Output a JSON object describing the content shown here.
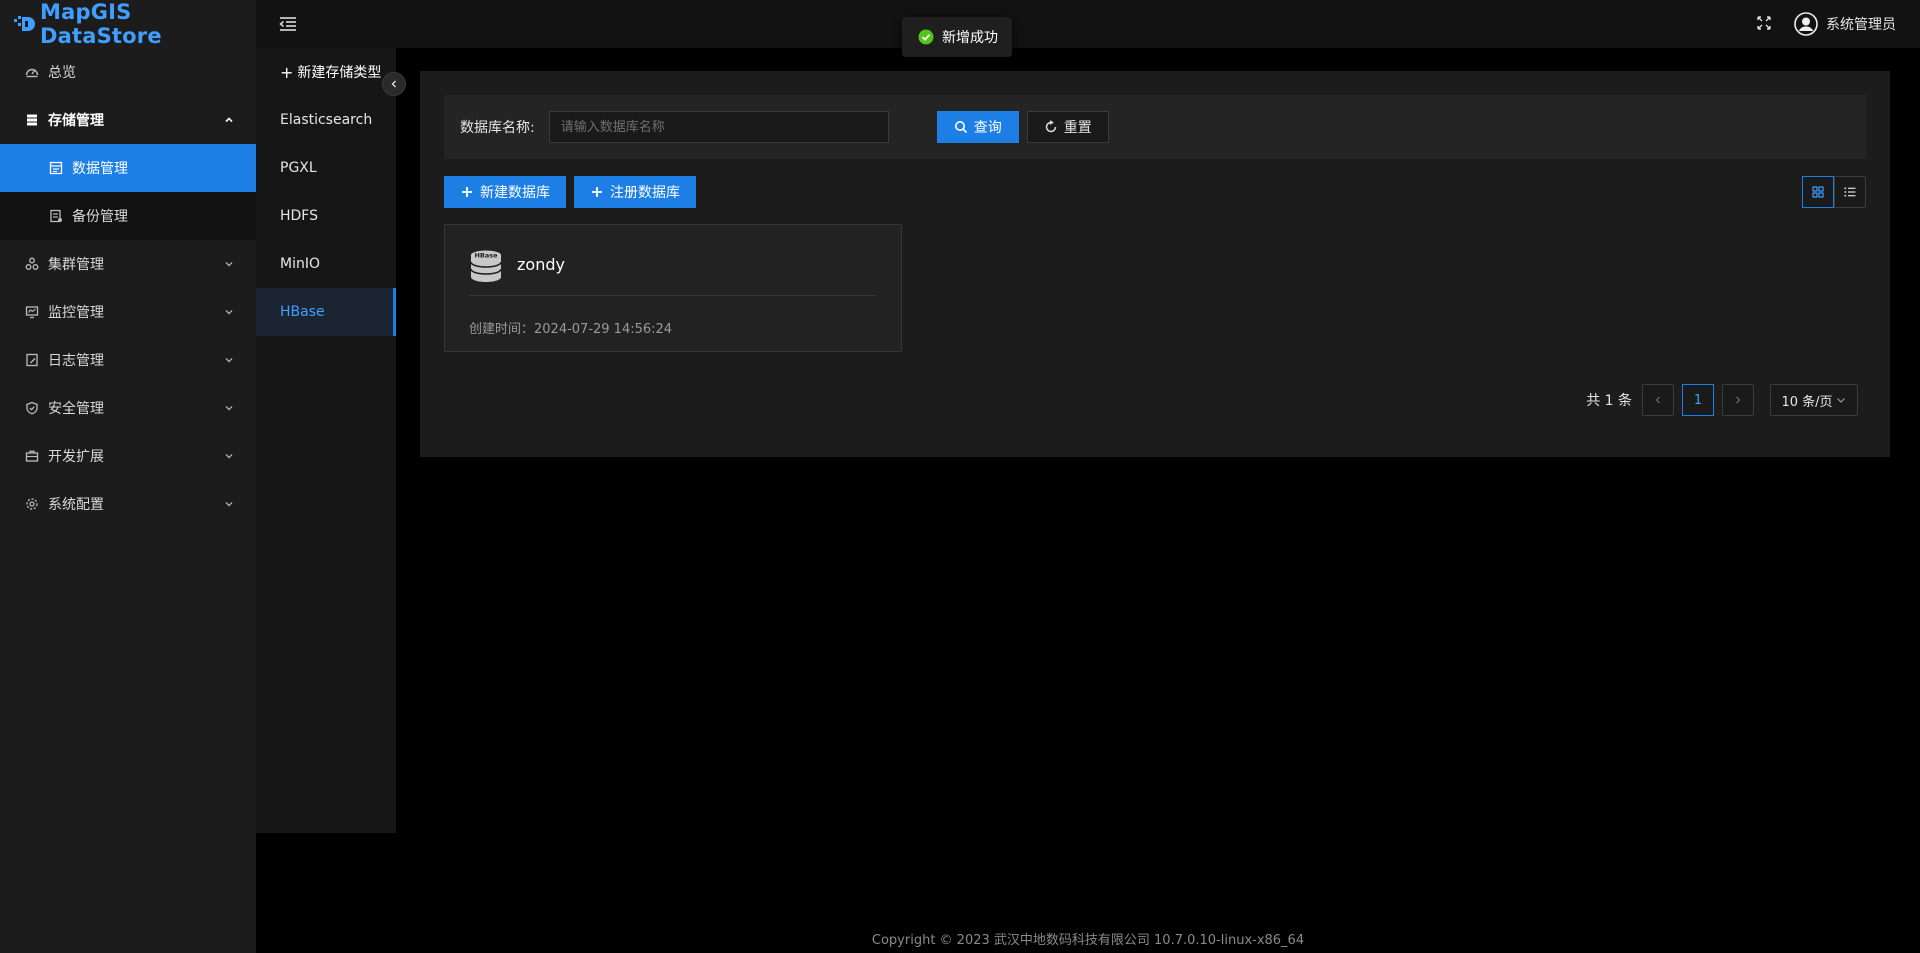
{
  "brand": {
    "name": "MapGIS DataStore",
    "color": "#3f9fff"
  },
  "colors": {
    "accent": "#1d7ee6",
    "success": "#52c41a"
  },
  "sidebar": {
    "items": [
      {
        "label": "总览",
        "icon": "dashboard-icon"
      },
      {
        "label": "存储管理",
        "icon": "storage-icon",
        "expanded": true,
        "children": [
          {
            "label": "数据管理",
            "icon": "data-manage-icon",
            "active": true
          },
          {
            "label": "备份管理",
            "icon": "backup-icon"
          }
        ]
      },
      {
        "label": "集群管理",
        "icon": "cluster-icon"
      },
      {
        "label": "监控管理",
        "icon": "monitor-icon"
      },
      {
        "label": "日志管理",
        "icon": "log-icon"
      },
      {
        "label": "安全管理",
        "icon": "shield-icon"
      },
      {
        "label": "开发扩展",
        "icon": "toolbox-icon"
      },
      {
        "label": "系统配置",
        "icon": "gear-icon"
      }
    ]
  },
  "topbar": {
    "user_name": "系统管理员"
  },
  "toast": {
    "message": "新增成功"
  },
  "storage_types": {
    "new_label": "新建存储类型",
    "items": [
      "Elasticsearch",
      "PGXL",
      "HDFS",
      "MinIO",
      "HBase"
    ],
    "active": "HBase"
  },
  "search": {
    "label": "数据库名称:",
    "placeholder": "请输入数据库名称",
    "value": "",
    "query_label": "查询",
    "reset_label": "重置"
  },
  "actions": {
    "new_db": "新建数据库",
    "register_db": "注册数据库"
  },
  "view_mode": "grid",
  "databases": [
    {
      "name": "zondy",
      "type_badge": "HBase",
      "created": "创建时间：2024-07-29 14:56:24"
    }
  ],
  "pagination": {
    "total_text": "共 1 条",
    "current_page": "1",
    "page_size": "10 条/页"
  },
  "footer": {
    "text": "Copyright © 2023 武汉中地数码科技有限公司 10.7.0.10-linux-x86_64"
  }
}
